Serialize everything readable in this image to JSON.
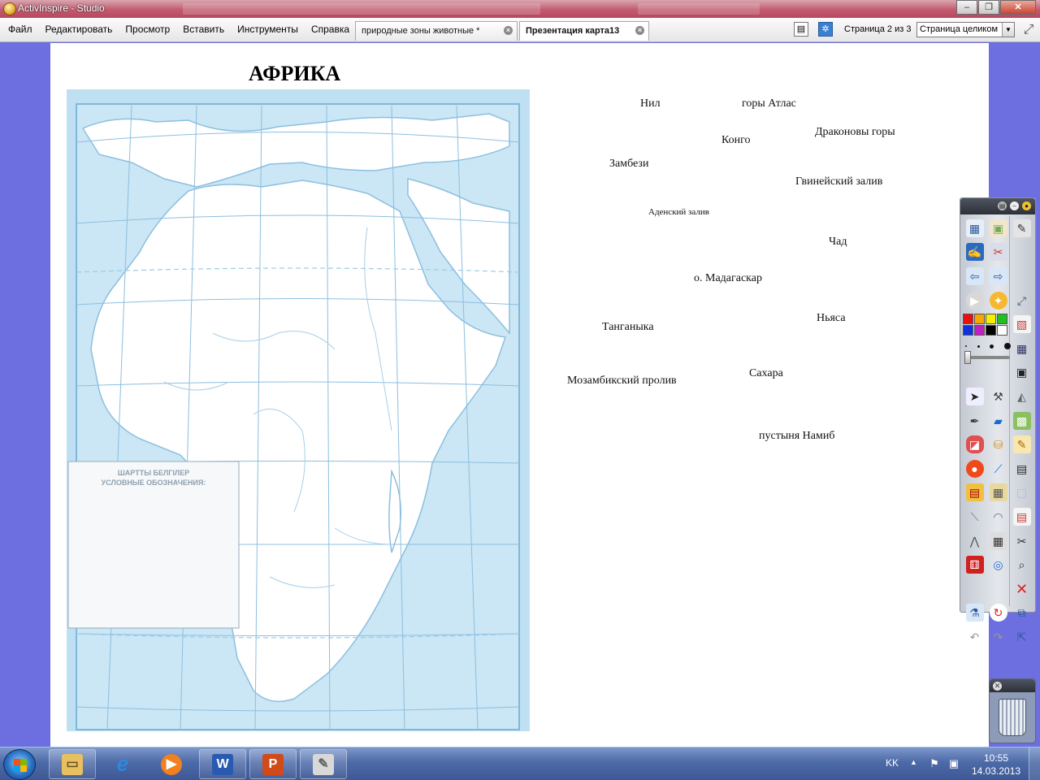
{
  "window": {
    "title": "ActivInspire - Studio",
    "min": "‒",
    "max": "❐",
    "close": "✕"
  },
  "menu": [
    "Файл",
    "Редактировать",
    "Просмотр",
    "Вставить",
    "Инструменты",
    "Справка"
  ],
  "tabs": [
    {
      "label": "природные зоны животные *",
      "active": false
    },
    {
      "label": "Презентация карта13",
      "active": true
    }
  ],
  "page_nav": {
    "label": "Страница 2 из 3",
    "zoom": "Страница целиком"
  },
  "slide": {
    "title": "АФРИКА",
    "legend": "ШАРТТЫ БЕЛГІЛЕР\nУСЛОВНЫЕ ОБОЗНАЧЕНИЯ:",
    "labels": {
      "nil": "Нил",
      "atlas": "горы Атлас",
      "kongo": "Конго",
      "drakon": "Драконовы горы",
      "zambezi": "Замбези",
      "guinea": "Гвинейский залив",
      "aden": "Аденский залив",
      "chad": "Чад",
      "madagascar": "о. Мадагаскар",
      "tanganyika": "Танганыка",
      "nyasa": "Ньяса",
      "mozambique": "Мозамбикский пролив",
      "sahara": "Сахара",
      "namib": "пустыня Намиб"
    }
  },
  "toolbox": {
    "colors": [
      "#e81010",
      "#f7a800",
      "#f5f000",
      "#21c021",
      "#1030e0",
      "#c020c0",
      "#000000",
      "#ffffff"
    ]
  },
  "taskbar": {
    "lang": "KK",
    "time": "10:55",
    "date": "14.03.2013"
  }
}
